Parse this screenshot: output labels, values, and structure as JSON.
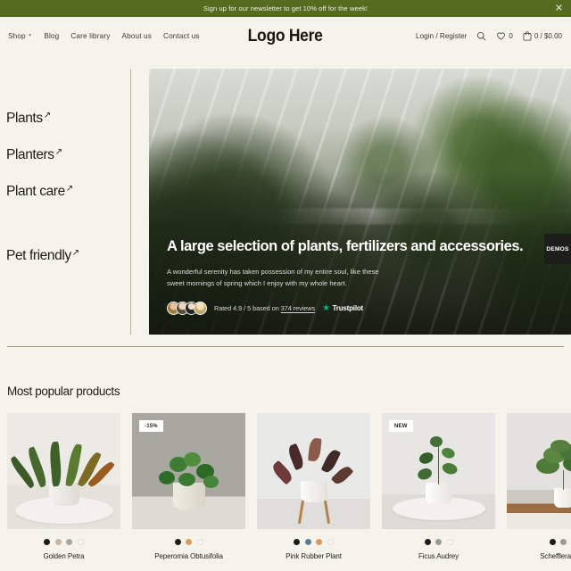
{
  "announcement": {
    "text": "Sign up for our newsletter to get 10% off for the week!",
    "close_icon": "close-icon",
    "bg_color": "#576b1e"
  },
  "header": {
    "logo": "Logo Here",
    "nav": [
      {
        "label": "Shop",
        "has_dropdown": true
      },
      {
        "label": "Blog",
        "has_dropdown": false
      },
      {
        "label": "Care library",
        "has_dropdown": false
      },
      {
        "label": "About us",
        "has_dropdown": false
      },
      {
        "label": "Contact us",
        "has_dropdown": false
      }
    ],
    "login_label": "Login / Register",
    "search_icon": "search-icon",
    "wishlist_icon": "heart-icon",
    "wishlist_count": "0",
    "cart_icon": "bag-icon",
    "cart_summary": "0 / $0.00"
  },
  "sidebar": {
    "links": [
      {
        "label": "Plants",
        "arrow": "↗"
      },
      {
        "label": "Planters",
        "arrow": "↗"
      },
      {
        "label": "Plant care",
        "arrow": "↗"
      },
      {
        "label": "Pet friendly",
        "arrow": "↗"
      }
    ]
  },
  "hero": {
    "headline": "A large selection of plants, fertilizers and accessories.",
    "body": "A wonderful serenity has taken possession of my entire soul, like these sweet mornings of spring which I enjoy with my whole heart.",
    "rating_prefix": "Rated 4.9 / 5 based on",
    "rating_reviews": "374 reviews",
    "rating_score": "4.9",
    "rating_max": "5",
    "review_count": "374",
    "trustpilot_label": "Trustpilot",
    "trustpilot_star_color": "#00b67a",
    "avatar_count": 4
  },
  "demos_tab": {
    "label": "DEMOS"
  },
  "products_section": {
    "title": "Most popular products",
    "items": [
      {
        "name": "Golden Petra",
        "badge": null,
        "swatches": [
          "#1c1c1c",
          "#c4b7a6",
          "#a8a6a1",
          "#f6f5f1"
        ]
      },
      {
        "name": "Peperomia Obtusifolia",
        "badge": "-15%",
        "swatches": [
          "#1c1c1c",
          "#d79a62",
          "#f6f4ee"
        ]
      },
      {
        "name": "Pink Rubber Plant",
        "badge": null,
        "swatches": [
          "#1c1c1c",
          "#5e7d95",
          "#d79a62",
          "#f6f4ee"
        ]
      },
      {
        "name": "Ficus Audrey",
        "badge": "NEW",
        "swatches": [
          "#1c1c1c",
          "#9a9a99",
          "#f6f4ee"
        ]
      },
      {
        "name": "Schefflera Tree",
        "badge": null,
        "swatches": [
          "#1c1c1c",
          "#9a9a99",
          "#f6f4ee"
        ]
      }
    ]
  },
  "theme": {
    "page_bg": "#f4f3ec",
    "olive": "#576b1e",
    "divider": "#9a9a6e",
    "text": "#1d1d16"
  }
}
